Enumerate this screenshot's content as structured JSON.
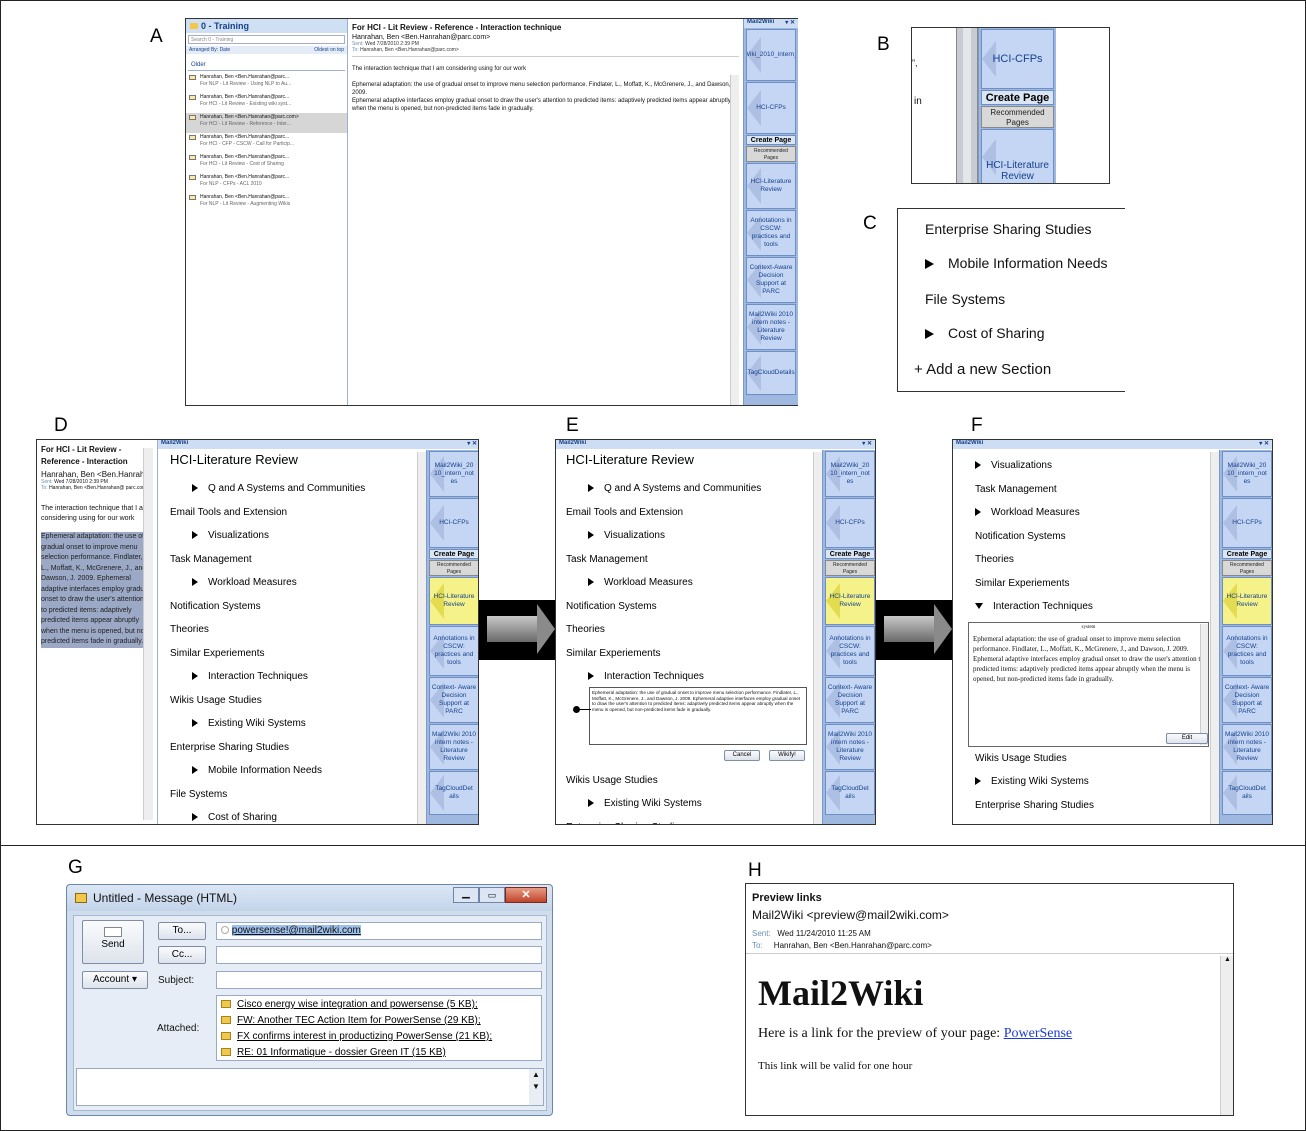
{
  "labels": {
    "a": "A",
    "b": "B",
    "c": "C",
    "d": "D",
    "e": "E",
    "f": "F",
    "g": "G",
    "h": "H"
  },
  "panelA": {
    "folder_title": "0 - Training",
    "search_placeholder": "Search 0 - Training",
    "arranged_by": "Arranged By: Date",
    "sort_order": "Oldest on top",
    "group": "Older",
    "items": [
      {
        "from": "Hanrahan, Ben <Ben.Hanrahan@parc...",
        "subject": "For NLP - Lit Review - Using NLP to Au..."
      },
      {
        "from": "Hanrahan, Ben <Ben.Hanrahan@parc...",
        "subject": "For HCI - Lit Review - Existing wiki syst..."
      },
      {
        "from": "Hanrahan, Ben <Ben.Hanrahan@parc.com>",
        "subject": "For HCI - Lit Review - Reference - Inter..."
      },
      {
        "from": "Hanrahan, Ben <Ben.Hanrahan@parc...",
        "subject": "For HCI - CFP - CSCW - Call for Particip..."
      },
      {
        "from": "Hanrahan, Ben <Ben.Hanrahan@parc...",
        "subject": "For HCI - Lit Review - Cost of Sharing"
      },
      {
        "from": "Hanrahan, Ben <Ben.Hanrahan@parc...",
        "subject": "For NLP - CFPs - ACL 2010"
      },
      {
        "from": "Hanrahan, Ben <Ben.Hanrahan@parc...",
        "subject": "For NLP - Lit Review - Augmenting Wikis"
      }
    ],
    "subject": "For HCI - Lit Review - Reference - Interaction technique",
    "from": "Hanrahan, Ben <Ben.Hanrahan@parc.com>",
    "sent_label": "Sent:",
    "sent": "Wed 7/28/2010 2:39 PM",
    "to_label": "To:",
    "to": "Hanrahan, Ben <Ben.Hanrahan@parc.com>",
    "body1": "The interaction technique that I am considering using for our work",
    "body2": "Ephemeral adaptation: the use of gradual onset to improve menu selection performance.  Findlater, L., Moffatt, K., McGrenere, J., and Dawson, J. 2009.",
    "body3": "Ephemeral adaptive interfaces employ gradual onset to draw the user's attention to predicted items: adaptively predicted items appear abruptly when the menu is opened, but non-predicted items fade in gradually."
  },
  "sidebar": {
    "title": "Mail2Wiki",
    "tiles": [
      "Mail2Wiki_2010_intern_notes",
      "HCI-CFPs",
      "HCI-Literature Review",
      "Annotations in CSCW: practices and tools",
      "Context-Aware Decision Support at PARC",
      "Mail2Wiki 2010 intern notes - Literature Review",
      "TagCloudDetails"
    ],
    "tiles_d": [
      "Mail2Wiki_20 10_intern_not es",
      "HCI-CFPs",
      "HCI-Literature Review",
      "Annotations in CSCW: practices and tools",
      "Context- Aware Decision Support at PARC",
      "Mail2Wiki 2010 intern notes - Literature Review",
      "TagCloudDet ails"
    ],
    "create_page": "Create Page",
    "recommended": "Recommended Pages"
  },
  "panelB": {
    "tile1": "HCI-CFPs",
    "create_page": "Create Page",
    "recommended": "Recommended Pages",
    "tile2": "HCI-Literature Review",
    "frag1": "”,",
    "frag2": "in"
  },
  "panelC": {
    "items": [
      "Enterprise Sharing Studies",
      "Mobile Information Needs",
      "File Systems",
      "Cost of Sharing",
      "+ Add a new Section"
    ]
  },
  "panelD": {
    "subject": "For HCI - Lit Review - Reference - Interaction",
    "from": "Hanrahan, Ben <Ben.Hanraha",
    "sent_label": "Sent:",
    "sent": "Wed 7/28/2010 2:39 PM",
    "to_label": "To:",
    "to": "Hanrahan, Ben <Ben.Hanrahan@ parc.com>",
    "intro": "The interaction technique that I am considering using for our work",
    "selected": "Ephemeral adaptation: the use of gradual onset to improve menu selection performance.  Findlater, L., Moffatt, K., McGrenere, J., and Dawson, J. 2009. Ephemeral adaptive interfaces employ gradual onset to draw the user's attention to predicted items: adaptively predicted items appear abruptly when the menu is opened, but non-predicted items fade in gradually."
  },
  "wiki": {
    "title": "HCI-Literature Review",
    "items": [
      "Q and A Systems and Communities",
      "Email Tools and Extension",
      "Visualizations",
      "Task Management",
      "Workload Measures",
      "Notification Systems",
      "Theories",
      "Similar Experiements",
      "Interaction Techniques",
      "Wikis Usage Studies",
      "Existing Wiki Systems",
      "Enterprise Sharing Studies",
      "Mobile Information Needs",
      "File Systems",
      "Cost of Sharing"
    ],
    "popup_text": "Ephemeral adaptation: the use of gradual onset to improve menu selection performance.  Findlater, L., Moffatt, K., McGrenere, J., and Dawson, J. 2009. Ephemeral adaptive interfaces employ gradual onset to draw the user's attention to predicted items: adaptively predicted items appear abruptly when the menu is opened, but non-predicted items fade in gradually.",
    "cancel": "Cancel",
    "wikify": "Wikify!",
    "edit": "Edit",
    "f_body": "Ephemeral adaptation: the use of gradual onset to improve menu selection performance. Findlater, L., Moffatt, K., McGrenere, J., and Dawson, J. 2009. Ephemeral adaptive interfaces employ gradual onset to draw the user's attention to predicted items: adaptively predicted items appear abruptly when the menu is opened, but non-predicted items fade in gradually.",
    "f_stub": "system",
    "cut": "Enterprise Sharing Studies"
  },
  "panelG": {
    "title": "Untitled - Message (HTML)",
    "send": "Send",
    "to": "To...",
    "cc": "Cc...",
    "account": "Account",
    "subject": "Subject:",
    "attached": "Attached:",
    "to_value": "powersense!@mail2wiki.com",
    "attachments": [
      "Cisco energy wise integration and powersense (5 KB);",
      "FW: Another TEC Action Item for PowerSense (29 KB);",
      "FX confirms interest in productizing PowerSense (21 KB);",
      "RE: 01 Informatique - dossier Green IT (15 KB)"
    ]
  },
  "panelH": {
    "subject": "Preview links",
    "from": "Mail2Wiki <preview@mail2wiki.com>",
    "sent_label": "Sent:",
    "sent": "Wed 11/24/2010 11:25 AM",
    "to_label": "To:",
    "to": "Hanrahan, Ben <Ben.Hanrahan@parc.com>",
    "heading": "Mail2Wiki",
    "line1": "Here is a link for the preview of your page: ",
    "link": "PowerSense",
    "line2": "This link will be valid for one hour"
  }
}
